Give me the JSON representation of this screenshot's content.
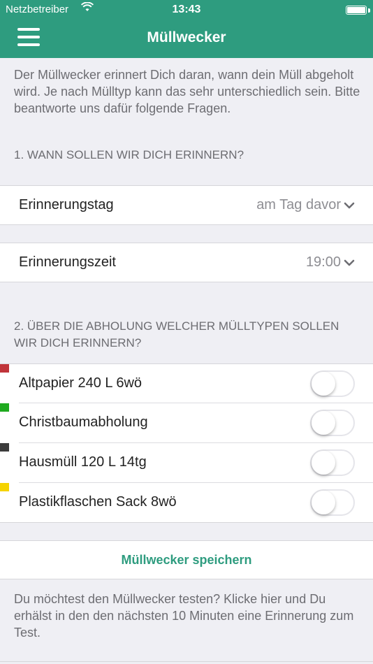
{
  "status_bar": {
    "carrier": "Netzbetreiber",
    "time": "13:43",
    "icons": [
      "wifi-icon",
      "battery-icon"
    ]
  },
  "header": {
    "title": "Müllwecker",
    "menu_icon": "hamburger-menu-icon"
  },
  "colors": {
    "header_bg": "#2e9c7f",
    "accent": "#2e9c7f"
  },
  "intro": "Der Müllwecker erinnert Dich daran, wann dein Müll abgeholt wird. Je nach Mülltyp kann das sehr unterschiedlich sein. Bitte beantworte uns dafür folgende Fragen.",
  "section1": {
    "heading": "1. WANN SOLLEN WIR DICH ERINNERN?"
  },
  "reminder_day": {
    "label": "Erinnerungstag",
    "value": "am Tag davor"
  },
  "reminder_time": {
    "label": "Erinnerungszeit",
    "value": "19:00"
  },
  "section2": {
    "heading": "2. ÜBER DIE ABHOLUNG WELCHER MÜLLTYPEN SOLLEN WIR DICH ERINNERN?"
  },
  "waste_types": [
    {
      "label": "Altpapier 240 L 6wö",
      "color": "#c0343a",
      "enabled": false
    },
    {
      "label": "Christbaumabholung",
      "color": "#1faa1f",
      "enabled": false
    },
    {
      "label": "Hausmüll 120 L 14tg",
      "color": "#3c3c3c",
      "enabled": false
    },
    {
      "label": "Plastikflaschen Sack 8wö",
      "color": "#f5d300",
      "enabled": false
    }
  ],
  "save_button": {
    "label": "Müllwecker speichern"
  },
  "test_hint": "Du möchtest den Müllwecker testen? Klicke hier und Du erhälst in den den nächsten 10 Minuten eine Erinnerung zum Test."
}
